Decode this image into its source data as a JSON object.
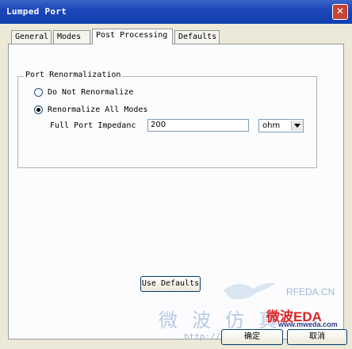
{
  "window": {
    "title": "Lumped Port"
  },
  "tabs": [
    "General",
    "Modes",
    "Post Processing",
    "Defaults"
  ],
  "active_tab": "Post Processing",
  "group": {
    "legend": "Port Renormalization",
    "options": [
      {
        "label": "Do Not Renormalize",
        "checked": false
      },
      {
        "label": "Renormalize All Modes",
        "checked": true
      }
    ],
    "impedance_label": "Full Port Impedanc",
    "impedance_value": "200",
    "unit_value": "ohm"
  },
  "buttons": {
    "use_defaults": "Use Defaults",
    "ok": "确定",
    "cancel": "取消"
  },
  "watermark": {
    "brand_small": "RFEDA.CN",
    "brand_big": "微波EDA",
    "url": "www.mweda.com",
    "cn_text": "微波仿真",
    "bbs": "http://bbs.rfeda.cn"
  },
  "colors": {
    "titlebar": "#1d47b8",
    "close": "#c64431",
    "watermark_red": "#d92626"
  }
}
